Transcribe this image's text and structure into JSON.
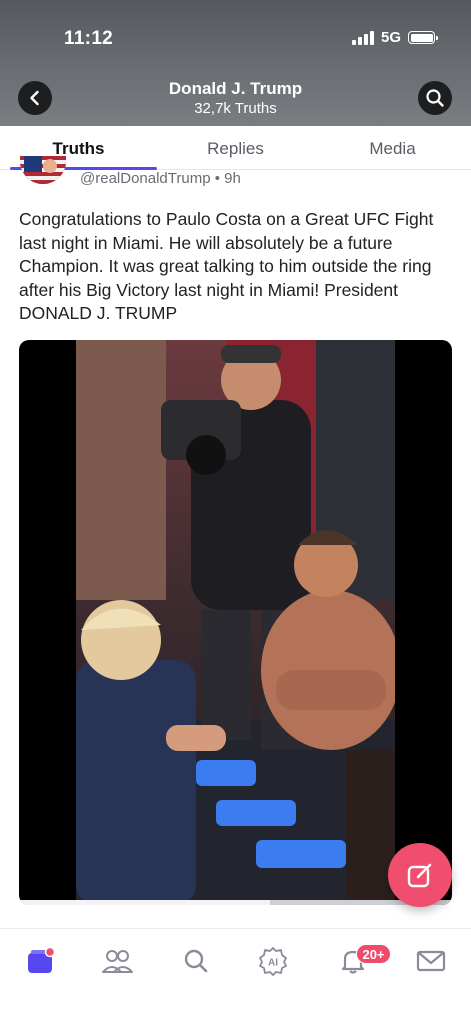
{
  "status_bar": {
    "time": "11:12",
    "network": "5G"
  },
  "header": {
    "title": "Donald J. Trump",
    "subtitle": "32,7k Truths",
    "back_icon": "chevron-left-icon",
    "search_icon": "search-icon"
  },
  "tabs": [
    {
      "label": "Truths",
      "active": true
    },
    {
      "label": "Replies",
      "active": false
    },
    {
      "label": "Media",
      "active": false
    }
  ],
  "post": {
    "handle": "@realDonaldTrump",
    "separator": "•",
    "time_ago": "9h",
    "text": "Congratulations to Paulo Costa on a Great UFC Fight last night in Miami. He will absolutely be a future Champion. It was great talking to him outside the ring after his Big Victory last night in Miami! President DONALD J. TRUMP",
    "video_progress": 0.58
  },
  "fab": {
    "icon": "compose-icon"
  },
  "bottom_nav": {
    "items": [
      "home-icon",
      "people-icon",
      "search-icon",
      "ai-icon",
      "bell-icon",
      "mail-icon"
    ],
    "notification_badge": "20+"
  },
  "colors": {
    "accent": "#5448ee",
    "fab": "#ef4e6e",
    "badge": "#ee4b6d"
  }
}
